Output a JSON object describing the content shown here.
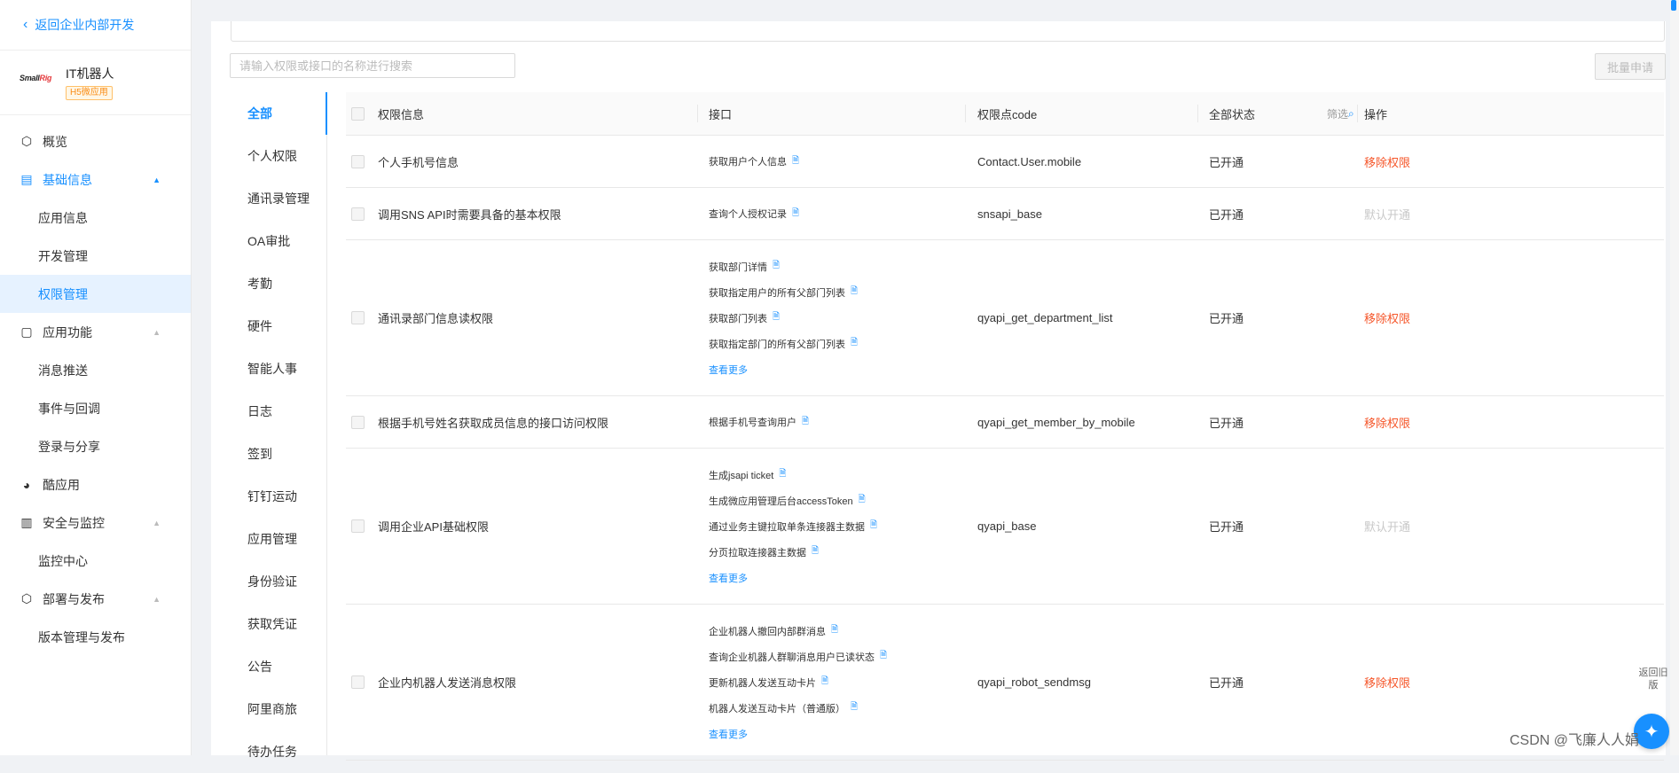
{
  "sidebar": {
    "back_label": "返回企业内部开发",
    "app": {
      "logo_text": "SmallRig",
      "name": "IT机器人",
      "tag": "H5微应用"
    },
    "groups": [
      {
        "label": "概览",
        "icon": "cube-icon",
        "active": false,
        "items": []
      },
      {
        "label": "基础信息",
        "icon": "document-icon",
        "active": true,
        "items": [
          {
            "label": "应用信息",
            "active": false
          },
          {
            "label": "开发管理",
            "active": false
          },
          {
            "label": "权限管理",
            "active": true
          }
        ]
      },
      {
        "label": "应用功能",
        "icon": "app-function-icon",
        "active": false,
        "items": [
          {
            "label": "消息推送",
            "active": false
          },
          {
            "label": "事件与回调",
            "active": false
          },
          {
            "label": "登录与分享",
            "active": false
          }
        ]
      },
      {
        "label": "酷应用",
        "icon": "cool-app-icon",
        "active": false,
        "items": []
      },
      {
        "label": "安全与监控",
        "icon": "bar-chart-icon",
        "active": false,
        "items": [
          {
            "label": "监控中心",
            "active": false
          }
        ]
      },
      {
        "label": "部署与发布",
        "icon": "deploy-icon",
        "active": false,
        "items": [
          {
            "label": "版本管理与发布",
            "active": false
          }
        ]
      }
    ]
  },
  "search": {
    "placeholder": "请输入权限或接口的名称进行搜索",
    "value": ""
  },
  "batch_button": "批量申请",
  "categories": [
    {
      "label": "全部",
      "active": true
    },
    {
      "label": "个人权限",
      "active": false
    },
    {
      "label": "通讯录管理",
      "active": false
    },
    {
      "label": "OA审批",
      "active": false
    },
    {
      "label": "考勤",
      "active": false
    },
    {
      "label": "硬件",
      "active": false
    },
    {
      "label": "智能人事",
      "active": false
    },
    {
      "label": "日志",
      "active": false
    },
    {
      "label": "签到",
      "active": false
    },
    {
      "label": "钉钉运动",
      "active": false
    },
    {
      "label": "应用管理",
      "active": false
    },
    {
      "label": "身份验证",
      "active": false
    },
    {
      "label": "获取凭证",
      "active": false
    },
    {
      "label": "公告",
      "active": false
    },
    {
      "label": "阿里商旅",
      "active": false
    },
    {
      "label": "待办任务",
      "active": false
    }
  ],
  "table": {
    "headers": {
      "info": "权限信息",
      "api": "接口",
      "code": "权限点code",
      "status": "全部状态",
      "filter": "筛选",
      "action": "操作"
    },
    "rows": [
      {
        "name": "个人手机号信息",
        "apis": [
          "获取用户个人信息"
        ],
        "more": "",
        "code": "Contact.User.mobile",
        "status": "已开通",
        "action": "移除权限",
        "action_type": "remove"
      },
      {
        "name": "调用SNS API时需要具备的基本权限",
        "apis": [
          "查询个人授权记录"
        ],
        "more": "",
        "code": "snsapi_base",
        "status": "已开通",
        "action": "默认开通",
        "action_type": "default"
      },
      {
        "name": "通讯录部门信息读权限",
        "apis": [
          "获取部门详情",
          "获取指定用户的所有父部门列表",
          "获取部门列表",
          "获取指定部门的所有父部门列表"
        ],
        "more": "查看更多",
        "code": "qyapi_get_department_list",
        "status": "已开通",
        "action": "移除权限",
        "action_type": "remove"
      },
      {
        "name": "根据手机号姓名获取成员信息的接口访问权限",
        "apis": [
          "根据手机号查询用户"
        ],
        "more": "",
        "code": "qyapi_get_member_by_mobile",
        "status": "已开通",
        "action": "移除权限",
        "action_type": "remove"
      },
      {
        "name": "调用企业API基础权限",
        "apis": [
          "生成jsapi ticket",
          "生成微应用管理后台accessToken",
          "通过业务主键拉取单条连接器主数据",
          "分页拉取连接器主数据"
        ],
        "more": "查看更多",
        "code": "qyapi_base",
        "status": "已开通",
        "action": "默认开通",
        "action_type": "default"
      },
      {
        "name": "企业内机器人发送消息权限",
        "apis": [
          "企业机器人撤回内部群消息",
          "查询企业机器人群聊消息用户已读状态",
          "更新机器人发送互动卡片",
          "机器人发送互动卡片（普通版）"
        ],
        "more": "查看更多",
        "code": "qyapi_robot_sendmsg",
        "status": "已开通",
        "action": "移除权限",
        "action_type": "remove"
      }
    ]
  },
  "float_panel": {
    "back_old_label": "返回旧版"
  },
  "watermark": "CSDN @飞廉人人娟",
  "colors": {
    "primary": "#1890ff",
    "danger": "#f5562a",
    "disabled": "#c8c8c8"
  }
}
